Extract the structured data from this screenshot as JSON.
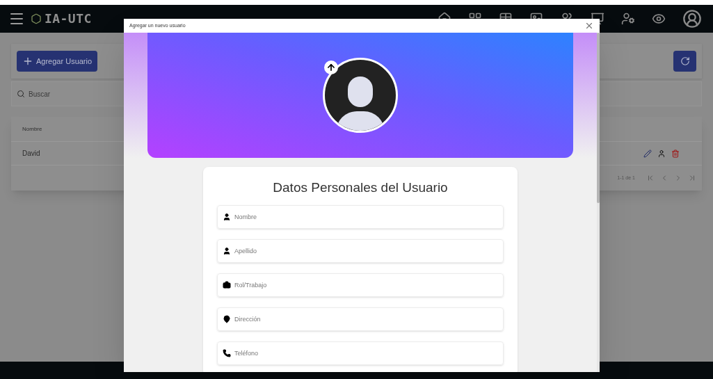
{
  "navbar": {
    "brand": "IA-UTC"
  },
  "page": {
    "add_button": "Agregar Usuario",
    "search": {
      "placeholder": "Buscar"
    },
    "table": {
      "columns": [
        "Nombre"
      ],
      "rows": [
        {
          "cells": [
            "David"
          ]
        }
      ]
    },
    "pagination": {
      "range": "1-1 de 1"
    }
  },
  "dialog": {
    "title": "Agregar un nuevo usuario",
    "card_title": "Datos Personales del Usuario",
    "fields": [
      {
        "kind": "person",
        "placeholder": "Nombre"
      },
      {
        "kind": "person",
        "placeholder": "Apellido"
      },
      {
        "kind": "briefcase",
        "placeholder": "Rol/Trabajo"
      },
      {
        "kind": "pin",
        "placeholder": "Dirección"
      },
      {
        "kind": "phone",
        "placeholder": "Teléfono"
      }
    ]
  }
}
